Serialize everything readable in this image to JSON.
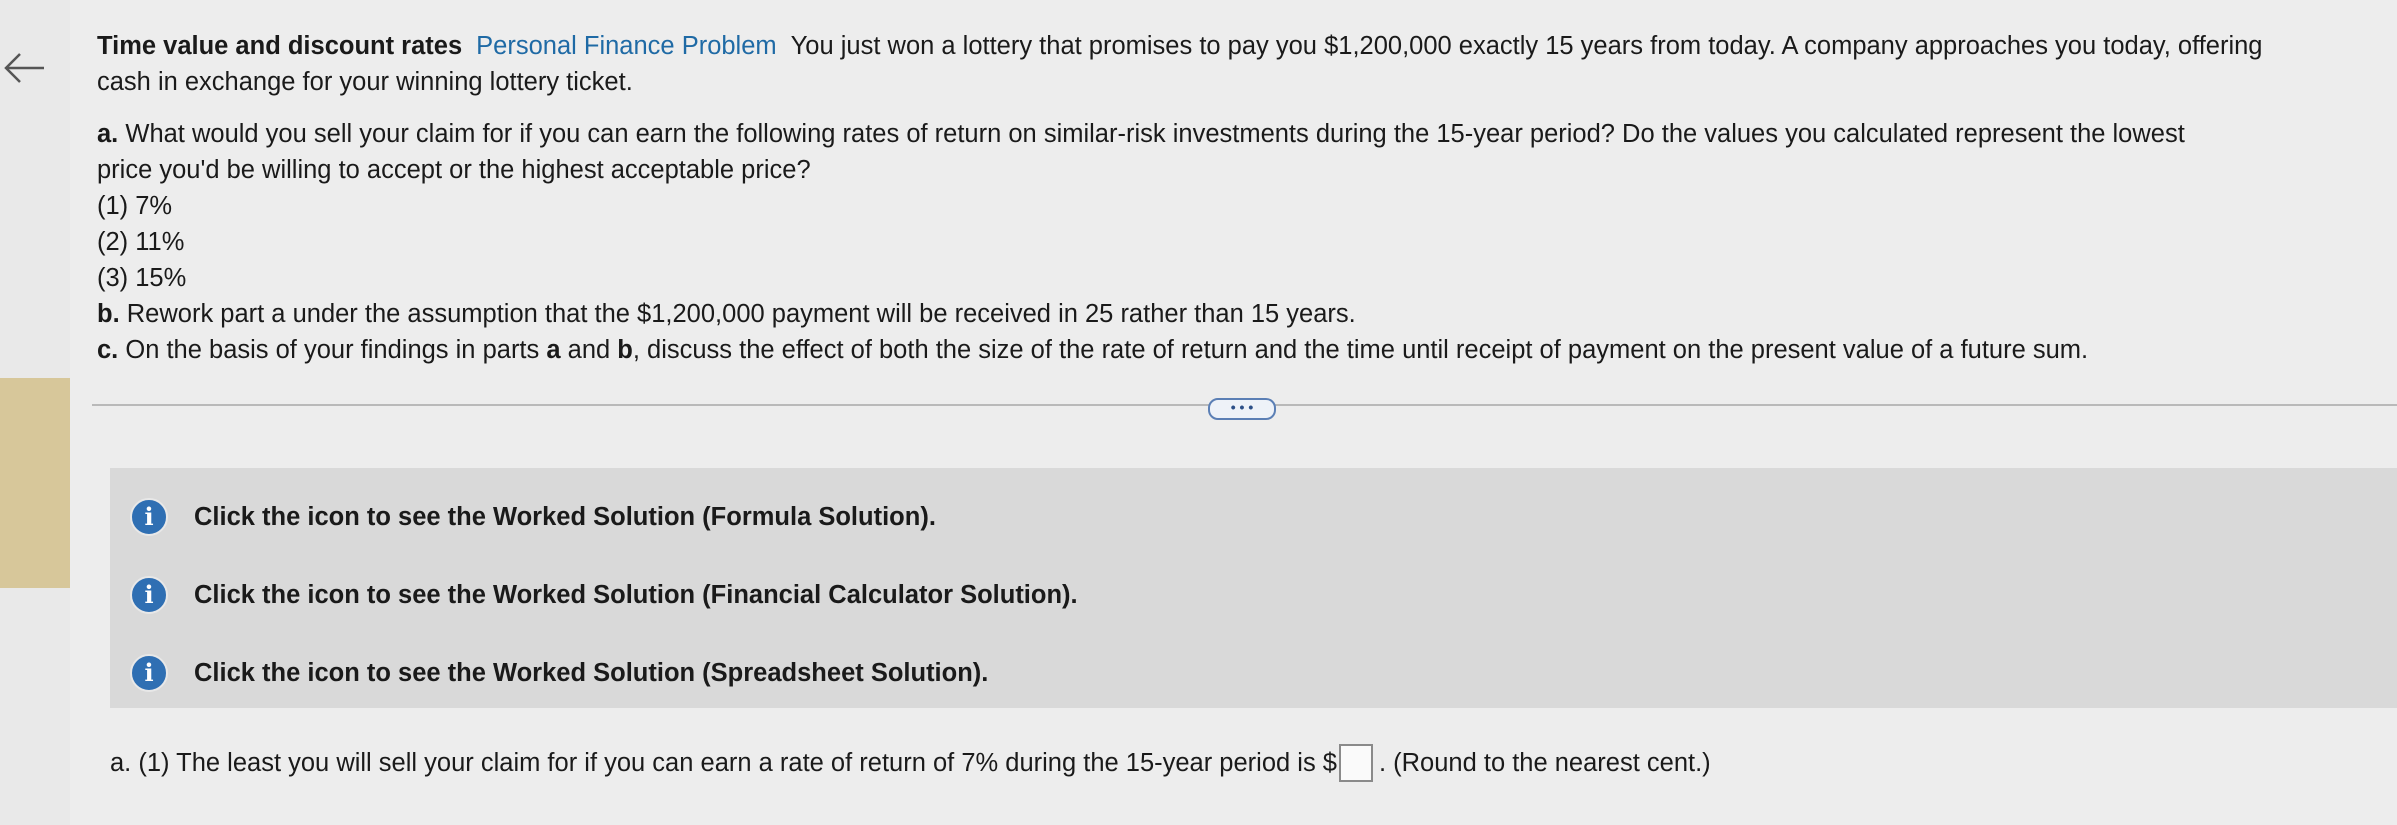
{
  "problem": {
    "title": "Time value and discount rates",
    "tag": "Personal Finance Problem",
    "intro_line1": "You just won a lottery that promises to pay you $1,200,000 exactly 15 years from today. A company approaches you today, offering",
    "intro_line2": "cash in exchange for your winning lottery ticket.",
    "part_a_letter": "a.",
    "part_a_text": "What would you sell your claim for if you can earn the following rates of return on similar-risk investments during the 15-year period?  Do the values you calculated represent the lowest",
    "part_a_text2": "price you'd be willing to accept or the highest acceptable price?",
    "rates": [
      "(1) 7%",
      "(2) 11%",
      "(3) 15%"
    ],
    "part_b_letter": "b.",
    "part_b_text": "Rework part a under the assumption that the $1,200,000 payment will be received in 25 rather than 15 years.",
    "part_c_letter": "c.",
    "part_c_pre": "On the basis of your findings in parts ",
    "part_c_a": "a",
    "part_c_and": " and ",
    "part_c_b": "b",
    "part_c_post": ", discuss the effect of both the size of the rate of return and the time until receipt of payment on the present value of a future sum."
  },
  "divider": {
    "button_label": "• • •"
  },
  "solutions": [
    {
      "icon": "info-icon",
      "label": "Click the icon to see the Worked Solution (Formula Solution)."
    },
    {
      "icon": "info-icon",
      "label": "Click the icon to see the Worked Solution (Financial Calculator Solution)."
    },
    {
      "icon": "info-icon",
      "label": "Click the icon to see the Worked Solution (Spreadsheet Solution)."
    }
  ],
  "answer": {
    "prefix": "a. (1) The least you will sell your claim for if you can earn a rate of return of 7% during the 15-year period is $",
    "input_value": "",
    "suffix": ".  (Round to the nearest cent.)"
  },
  "colors": {
    "link_blue": "#1f6aa5",
    "info_blue": "#2f6fb3",
    "tan_strip": "#d7c79a"
  }
}
